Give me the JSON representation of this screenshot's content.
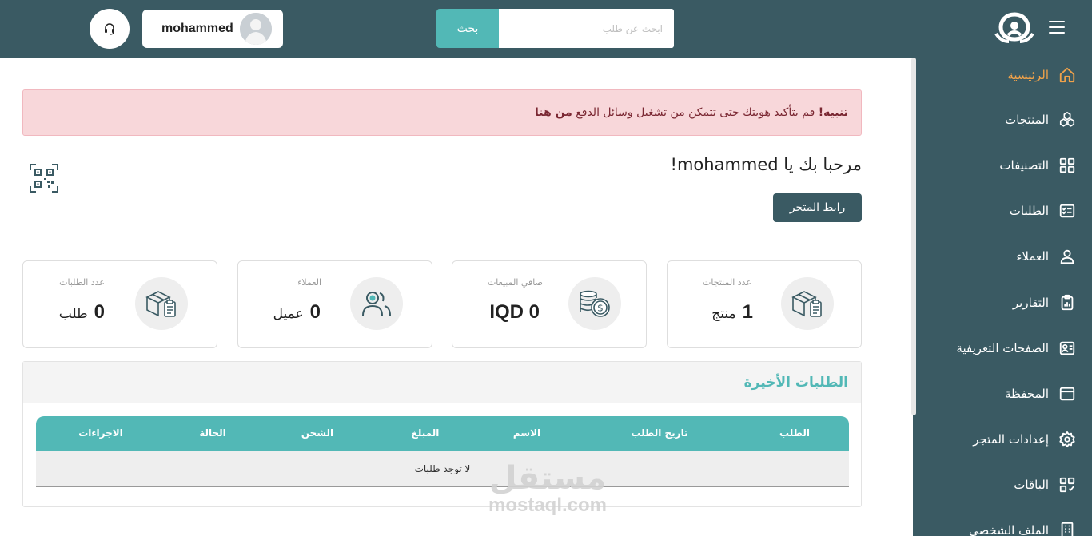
{
  "header": {
    "search": {
      "button_label": "بحث",
      "placeholder": "ابحث عن طلب"
    },
    "user": {
      "name": "mohammed"
    }
  },
  "sidebar": {
    "items": [
      {
        "label": "الرئيسية",
        "icon": "home-icon",
        "active": true
      },
      {
        "label": "المنتجات",
        "icon": "products-icon"
      },
      {
        "label": "التصنيفات",
        "icon": "grid-icon"
      },
      {
        "label": "الطلبات",
        "icon": "orders-list-icon"
      },
      {
        "label": "العملاء",
        "icon": "user-icon"
      },
      {
        "label": "التقارير",
        "icon": "report-icon"
      },
      {
        "label": "الصفحات التعريفية",
        "icon": "profile-card-icon"
      },
      {
        "label": "المحفظة",
        "icon": "wallet-icon"
      },
      {
        "label": "إعدادات المتجر",
        "icon": "gear-icon"
      },
      {
        "label": "الباقات",
        "icon": "packages-icon"
      },
      {
        "label": "الملف الشخصي",
        "icon": "building-icon"
      }
    ],
    "active_color": "#f0a24a"
  },
  "alert": {
    "strong": "تنبيه!",
    "text": " قم بتأكيد هويتك حتى تتمكن من تشغيل وسائل الدفع ",
    "link": "من هنا"
  },
  "main": {
    "welcome": "مرحبا بك يا mohammed!",
    "store_link_label": "رابط المتجر",
    "qr_icon": "qr-code-icon"
  },
  "stats": [
    {
      "title": "عدد المنتجات",
      "value": "1",
      "unit": "منتج",
      "icon": "box-clipboard-icon"
    },
    {
      "title": "صافي المبيعات",
      "value": "IQD 0",
      "unit": "",
      "icon": "coins-icon"
    },
    {
      "title": "العملاء",
      "value": "0",
      "unit": "عميل",
      "icon": "users-icon"
    },
    {
      "title": "عدد الطلبات",
      "value": "0",
      "unit": "طلب",
      "icon": "box-clipboard-icon"
    }
  ],
  "recent_orders": {
    "title": "الطلبات الأخيرة",
    "columns": [
      "الطلب",
      "تاريخ الطلب",
      "الاسم",
      "المبلغ",
      "الشحن",
      "الحالة",
      "الاجراءات"
    ],
    "empty_text": "لا توجد طلبات"
  },
  "watermark": {
    "arabic": "مستقل",
    "latin": "mostaql.com"
  },
  "colors": {
    "primary_dark": "#3a5a63",
    "teal": "#52b8b6",
    "alert_bg": "#f8d7da"
  }
}
